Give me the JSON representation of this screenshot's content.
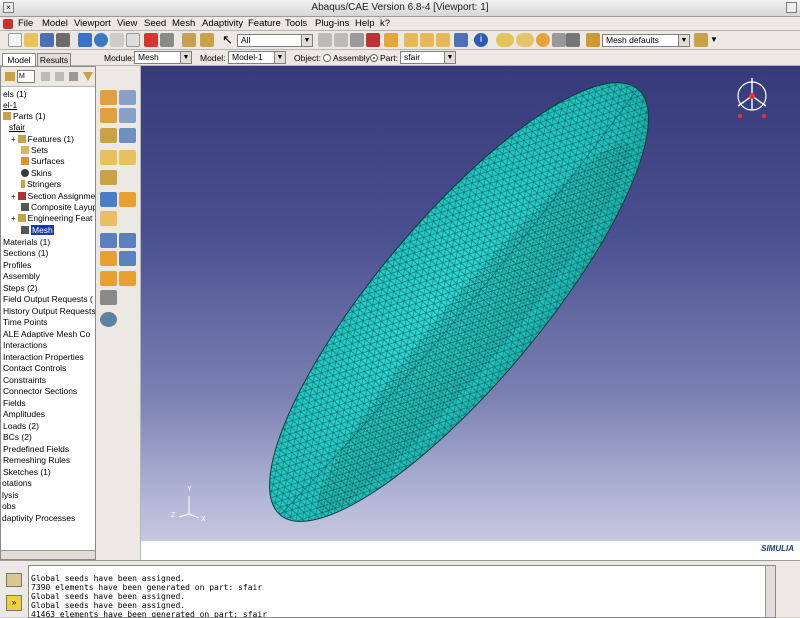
{
  "window": {
    "title": "Abaqus/CAE Version 6.8-4 [Viewport: 1]"
  },
  "menu": [
    "File",
    "Model",
    "Viewport",
    "View",
    "Seed",
    "Mesh",
    "Adaptivity",
    "Feature",
    "Tools",
    "Plug-ins",
    "Help",
    "k?"
  ],
  "toolbar": {
    "selection_filter": "All",
    "render_style": "Mesh defaults"
  },
  "context": {
    "module_label": "Module:",
    "module_value": "Mesh",
    "model_label": "Model:",
    "model_value": "Model-1",
    "object_label": "Object:",
    "assembly_label": "Assembly",
    "part_label": "Part:",
    "part_value": "sfair"
  },
  "tabs": {
    "model": "Model",
    "results": "Results"
  },
  "tree": {
    "filter_value": "M",
    "items": [
      {
        "label": "els (1)"
      },
      {
        "label": "el-1"
      },
      {
        "label": "Parts (1)"
      },
      {
        "label": "sfair"
      },
      {
        "label": "Features (1)"
      },
      {
        "label": "Sets"
      },
      {
        "label": "Surfaces"
      },
      {
        "label": "Skins"
      },
      {
        "label": "Stringers"
      },
      {
        "label": "Section Assignme"
      },
      {
        "label": "Composite Layup"
      },
      {
        "label": "Engineering Feat"
      },
      {
        "label": "Mesh"
      },
      {
        "label": "Materials (1)"
      },
      {
        "label": "Sections (1)"
      },
      {
        "label": "Profiles"
      },
      {
        "label": "Assembly"
      },
      {
        "label": "Steps (2)"
      },
      {
        "label": "Field Output Requests ("
      },
      {
        "label": "History Output Requests"
      },
      {
        "label": "Time Points"
      },
      {
        "label": "ALE Adaptive Mesh Co"
      },
      {
        "label": "Interactions"
      },
      {
        "label": "Interaction Properties"
      },
      {
        "label": "Contact Controls"
      },
      {
        "label": "Constraints"
      },
      {
        "label": "Connector Sections"
      },
      {
        "label": "Fields"
      },
      {
        "label": "Amplitudes"
      },
      {
        "label": "Loads (2)"
      },
      {
        "label": "BCs (2)"
      },
      {
        "label": "Predefined Fields"
      },
      {
        "label": "Remeshing Rules"
      },
      {
        "label": "Sketches (1)"
      },
      {
        "label": "otations"
      },
      {
        "label": "lysis"
      },
      {
        "label": "obs"
      },
      {
        "label": "daptivity Processes"
      }
    ]
  },
  "messages": [
    "Global seeds have been assigned.",
    "7390 elements have been generated on part: sfair",
    "Global seeds have been assigned.",
    "Global seeds have been assigned.",
    "41463 elements have been generated on part: sfair"
  ],
  "viewport": {
    "triad_labels": [
      "Y",
      "Z",
      "X"
    ],
    "logo_text": "SIMULIA",
    "mesh_color": "#27c8c4"
  }
}
